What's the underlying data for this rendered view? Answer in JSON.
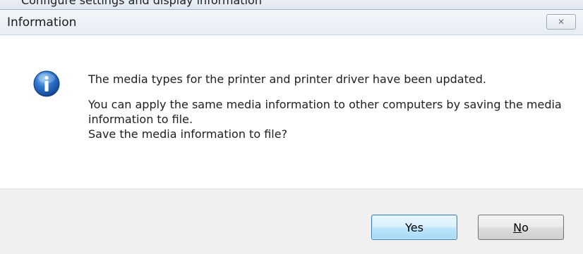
{
  "top_strip": {
    "clipped_text": "Configure settings and display information"
  },
  "dialog": {
    "title": "Information",
    "close_glyph": "✕",
    "icon": "information-icon",
    "message_line1": "The media types for the printer and printer driver have been updated.",
    "message_line2": "You can apply the same media information to other computers by saving the media information to file.",
    "message_line3": "Save the media information to file?"
  },
  "buttons": {
    "yes_label": "Yes",
    "no_mnemonic": "N",
    "no_rest": "o"
  },
  "colors": {
    "icon_blue": "#1f5fb0",
    "default_button_border": "#3c7fb1"
  }
}
